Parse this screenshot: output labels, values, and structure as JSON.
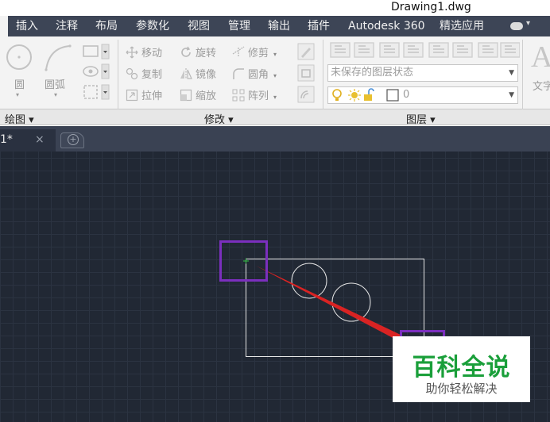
{
  "window": {
    "title": "Drawing1.dwg"
  },
  "ribbon_tabs": [
    "插入",
    "注释",
    "布局",
    "参数化",
    "视图",
    "管理",
    "输出",
    "插件",
    "Autodesk 360",
    "精选应用"
  ],
  "draw_panel": {
    "circle_label": "圆",
    "arc_label": "圆弧",
    "panel_label": "绘图 ▾"
  },
  "modify_panel": {
    "tools": [
      "移动",
      "旋转",
      "修剪",
      "复制",
      "镜像",
      "圆角",
      "拉伸",
      "缩放",
      "阵列"
    ],
    "panel_label": "修改 ▾"
  },
  "layers_panel": {
    "layer_state": "未保存的图层状态",
    "current_layer": "0",
    "panel_label": "图层 ▾"
  },
  "annotation_panel": {
    "text_label": "文字"
  },
  "doc_tab": {
    "name": "1*",
    "close": "×"
  },
  "watermark": {
    "main": "百科全说",
    "sub": "助你轻松解决"
  },
  "colors": {
    "canvas_bg": "#212834",
    "highlight_box": "#7b2fbe",
    "arrow": "#d92323",
    "ribbon_tab_bar": "#3d4556",
    "brand_green": "#1a9f3a"
  }
}
